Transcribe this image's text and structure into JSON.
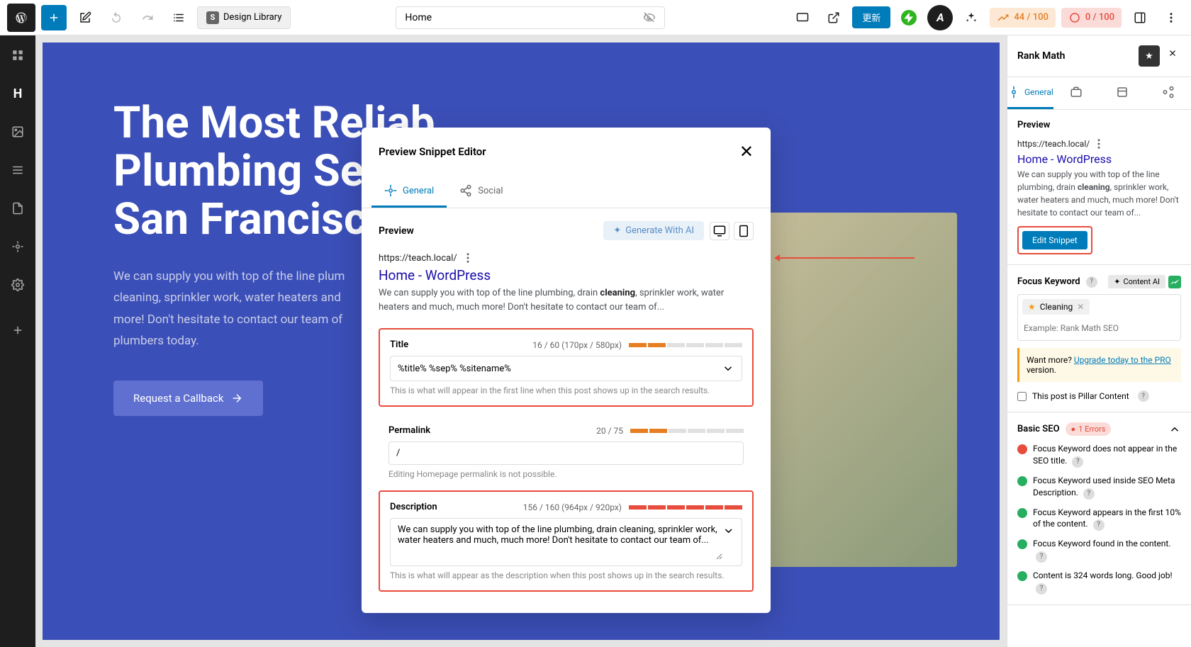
{
  "topbar": {
    "design_library": "Design Library",
    "page_title": "Home",
    "update": "更新",
    "score1": "44 / 100",
    "score2": "0 / 100"
  },
  "leftbar": {},
  "hero": {
    "title_l1": "The Most Reliab",
    "title_l2": "Plumbing Servi",
    "title_l3": "San Francisco",
    "text": "We can supply you with top of the line plum cleaning, sprinkler work, water heaters and more! Don't hesitate to contact our team of plumbers today.",
    "cta": "Request a Callback"
  },
  "modal": {
    "title": "Preview Snippet Editor",
    "tab_general": "General",
    "tab_social": "Social",
    "preview_label": "Preview",
    "generate_ai": "Generate With AI",
    "snippet_url": "https://teach.local/",
    "snippet_title": "Home - WordPress",
    "snippet_desc_1": "We can supply you with top of the line plumbing, drain ",
    "snippet_desc_kw": "cleaning",
    "snippet_desc_2": ", sprinkler work, water heaters and much, much more! Don't hesitate to contact our team of...",
    "title_section": {
      "label": "Title",
      "stats": "16 / 60 (170px / 580px)",
      "value": "%title% %sep% %sitename%",
      "hint": "This is what will appear in the first line when this post shows up in the search results."
    },
    "permalink_section": {
      "label": "Permalink",
      "stats": "20 / 75",
      "value": "/",
      "hint": "Editing Homepage permalink is not possible."
    },
    "description_section": {
      "label": "Description",
      "stats": "156 / 160 (964px / 920px)",
      "value": "We can supply you with top of the line plumbing, drain cleaning, sprinkler work, water heaters and much, much more! Don't hesitate to contact our team of...",
      "hint": "This is what will appear as the description when this post shows up in the search results."
    }
  },
  "sidebar": {
    "title": "Rank Math",
    "tab_general": "General",
    "preview_label": "Preview",
    "url": "https://teach.local/",
    "snippet_title": "Home - WordPress",
    "desc_1": "We can supply you with top of the line plumbing, drain ",
    "desc_kw": "cleaning",
    "desc_2": ", sprinkler work, water heaters and much, much more! Don't hesitate to contact our team of...",
    "edit_snippet": "Edit Snippet",
    "focus_keyword_label": "Focus Keyword",
    "content_ai": "Content AI",
    "keyword_tag": "Cleaning",
    "keyword_placeholder": "Example: Rank Math SEO",
    "upgrade_text_1": "Want more? ",
    "upgrade_link": "Upgrade today to the PRO",
    "upgrade_text_2": " version.",
    "pillar_label": "This post is Pillar Content",
    "basic_seo_label": "Basic SEO",
    "errors_badge": "1 Errors",
    "checks": [
      {
        "status": "err",
        "text": "Focus Keyword does not appear in the SEO title."
      },
      {
        "status": "ok",
        "text": "Focus Keyword used inside SEO Meta Description."
      },
      {
        "status": "ok",
        "text": "Focus Keyword appears in the first 10% of the content."
      },
      {
        "status": "ok",
        "text": "Focus Keyword found in the content."
      },
      {
        "status": "ok",
        "text": "Content is 324 words long. Good job!"
      }
    ]
  }
}
